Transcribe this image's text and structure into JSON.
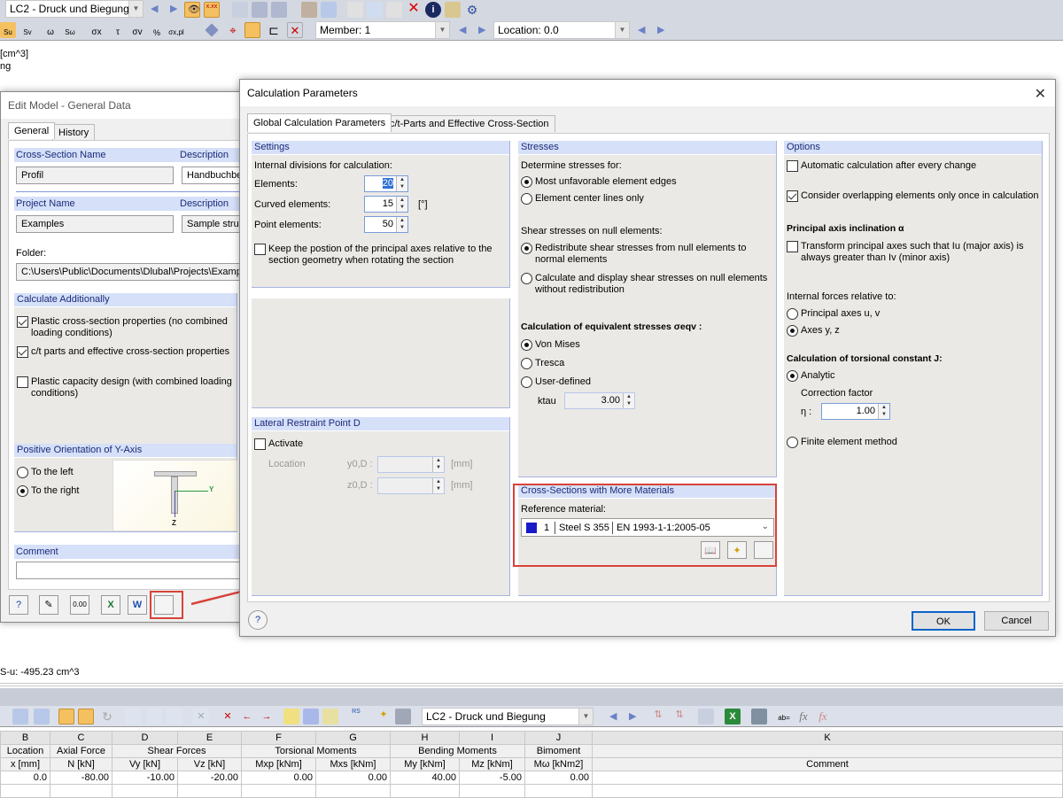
{
  "toolbar1": {
    "loadcase": "LC2 - Druck und Biegung"
  },
  "toolbar2": {
    "member_label": "Member: 1",
    "location_label": "Location: 0.0"
  },
  "background": {
    "line1": "[cm^3]",
    "line2": "ng",
    "stat_text": "S-u: -495.23 cm^3"
  },
  "edit_model": {
    "title": "Edit Model - General Data",
    "tabs": [
      "General",
      "History"
    ],
    "cs_name_label": "Cross-Section Name",
    "cs_desc_label": "Description",
    "cs_name": "Profil",
    "cs_desc": "Handbuchbei",
    "proj_name_label": "Project Name",
    "proj_desc_label": "Description",
    "proj_name": "Examples",
    "proj_desc": "Sample struc",
    "folder_label": "Folder:",
    "folder": "C:\\Users\\Public\\Documents\\Dlubal\\Projects\\Example",
    "calc_add_header": "Calculate Additionally",
    "calc_add": [
      {
        "label": "Plastic cross-section properties (no combined loading conditions)",
        "checked": true
      },
      {
        "label": "c/t parts and effective cross-section properties",
        "checked": true
      },
      {
        "label": "Plastic capacity design (with combined loading conditions)",
        "checked": false
      }
    ],
    "orient_header": "Positive Orientation of Y-Axis",
    "orient_left": "To the left",
    "orient_right": "To the right",
    "orient_selected": "right",
    "axis_y": "Y",
    "axis_z": "Z",
    "comment_label": "Comment",
    "comment": ""
  },
  "calc_params": {
    "title": "Calculation Parameters",
    "tabs": [
      "Global Calculation Parameters",
      "c/t-Parts and Effective Cross-Section"
    ],
    "settings": {
      "header": "Settings",
      "intro": "Internal divisions for calculation:",
      "elements_label": "Elements:",
      "elements": "20",
      "curved_label": "Curved elements:",
      "curved": "15",
      "curved_unit": "[°]",
      "point_label": "Point elements:",
      "point": "50",
      "keep_label": "Keep the postion of the principal axes relative to the section geometry when rotating the section",
      "keep_checked": false
    },
    "lateral": {
      "header": "Lateral Restraint Point D",
      "activate": "Activate",
      "activate_checked": false,
      "location": "Location",
      "y_label": "y0,D :",
      "z_label": "z0,D :",
      "unit": "[mm]"
    },
    "stresses": {
      "header": "Stresses",
      "determine_label": "Determine stresses for:",
      "opt_edges": "Most unfavorable element edges",
      "opt_center": "Element center lines only",
      "determine_selected": "edges",
      "shear_label": "Shear stresses on null elements:",
      "opt_redistribute": "Redistribute shear stresses from null elements to normal elements",
      "opt_calc_display": "Calculate and display shear stresses on null elements without redistribution",
      "shear_selected": "redistribute",
      "eqv_label": "Calculation of equivalent stresses σeqv :",
      "opt_vonmises": "Von Mises",
      "opt_tresca": "Tresca",
      "opt_user": "User-defined",
      "eqv_selected": "vonmises",
      "ktau_label": "ktau",
      "ktau": "3.00"
    },
    "materials": {
      "header": "Cross-Sections with More Materials",
      "ref_label": "Reference material:",
      "mat_no": "1",
      "mat_name": "Steel S 355",
      "mat_norm": "EN 1993-1-1:2005-05",
      "mat_color": "#1a1ac8"
    },
    "options": {
      "header": "Options",
      "auto_calc": "Automatic calculation after every change",
      "auto_calc_checked": false,
      "overlap": "Consider overlapping elements only once in calculation",
      "overlap_checked": true,
      "principal_header": "Principal axis inclination α",
      "transform": "Transform principal axes such that Iu (major axis) is always greater than Iv (minor axis)",
      "transform_checked": false,
      "forces_label": "Internal forces relative to:",
      "opt_principal": "Principal axes u, v",
      "opt_yz": "Axes y, z",
      "forces_selected": "yz",
      "torsion_label": "Calculation of torsional constant J:",
      "opt_analytic": "Analytic",
      "correction_label": "Correction factor",
      "eta_label": "η :",
      "eta": "1.00",
      "opt_fem": "Finite element method",
      "torsion_selected": "analytic"
    },
    "ok": "OK",
    "cancel": "Cancel"
  },
  "table_toolbar": {
    "loadcase": "LC2 - Druck und Biegung"
  },
  "table": {
    "col_letters": [
      "B",
      "C",
      "D",
      "E",
      "F",
      "G",
      "H",
      "I",
      "J",
      "K"
    ],
    "groups": [
      "Location",
      "Axial Force",
      "Shear Forces",
      "Torsional Moments",
      "Bending Moments",
      "Bimoment"
    ],
    "units": [
      "x [mm]",
      "N [kN]",
      "Vy [kN]",
      "Vz [kN]",
      "Mxp [kNm]",
      "Mxs [kNm]",
      "My [kNm]",
      "Mz [kNm]",
      "Mω [kNm2]",
      "Comment"
    ],
    "rows": [
      [
        "0.0",
        "-80.00",
        "-10.00",
        "-20.00",
        "0.00",
        "0.00",
        "40.00",
        "-5.00",
        "0.00",
        ""
      ]
    ]
  }
}
